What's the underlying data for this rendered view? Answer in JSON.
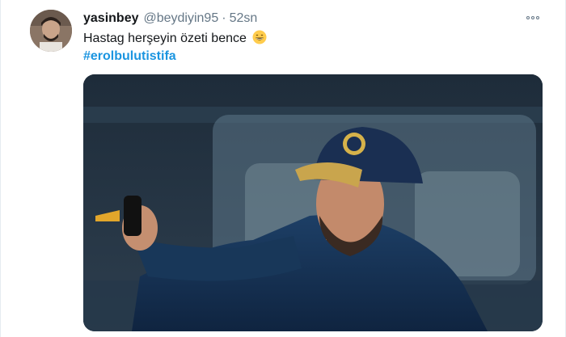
{
  "tweet": {
    "display_name": "yasinbey",
    "handle": "@beydiyin95",
    "separator": "·",
    "timestamp": "52sn",
    "text": "Hastag herşeyin özeti bence",
    "emoji": "grinning-face-emoji",
    "hashtag": "#erolbulutistifa",
    "more_icon": "more-horizontal-icon"
  },
  "colors": {
    "name": "#14171a",
    "muted": "#657786",
    "link": "#1b95e0"
  }
}
